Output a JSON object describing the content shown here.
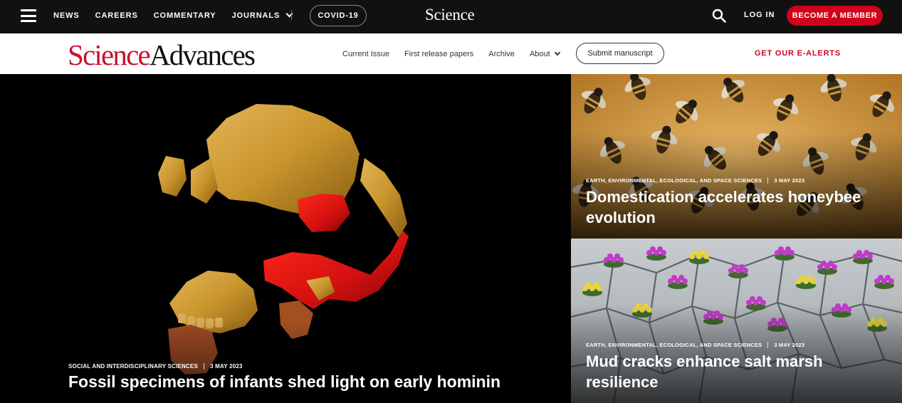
{
  "topbar": {
    "nav": [
      "NEWS",
      "CAREERS",
      "COMMENTARY",
      "JOURNALS"
    ],
    "covid_label": "COVID-19",
    "logo": "Science",
    "login_label": "LOG IN",
    "member_label": "BECOME A MEMBER",
    "icons": {
      "menu": "hamburger-menu-icon",
      "search": "search-icon",
      "dropdown": "chevron-down-icon"
    }
  },
  "journal_header": {
    "logo_part1": "Science",
    "logo_part2": "Advances",
    "nav": [
      "Current Issue",
      "First release papers",
      "Archive",
      "About"
    ],
    "submit_label": "Submit manuscript",
    "ealerts_label": "GET OUR E-ALERTS"
  },
  "hero": {
    "category": "SOCIAL AND INTERDISCIPLINARY SCIENCES",
    "date": "3 MAY 2023",
    "title": "Fossil specimens of infants shed light on early hominin"
  },
  "side_articles": [
    {
      "category": "EARTH, ENVIRONMENTAL, ECOLOGICAL, AND SPACE SCIENCES",
      "date": "3 MAY 2023",
      "title": "Domestication accelerates honeybee evolution"
    },
    {
      "category": "EARTH, ENVIRONMENTAL, ECOLOGICAL, AND SPACE SCIENCES",
      "date": "3 MAY 2023",
      "title": "Mud cracks enhance salt marsh resilience"
    }
  ],
  "colors": {
    "brand_red": "#d0021b",
    "topbar_bg": "#111111",
    "fossil_gold": "#c9952c",
    "fossil_red": "#d41010"
  }
}
